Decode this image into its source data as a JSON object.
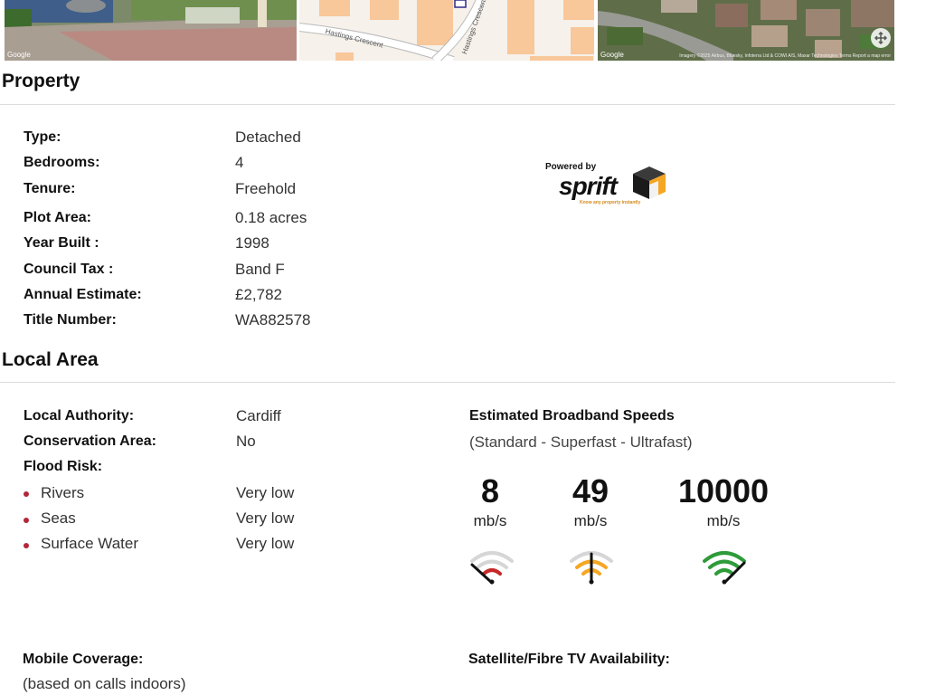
{
  "images": {
    "street_view_credit": "Google",
    "map_street_names": [
      "Hastings Crescent",
      "Hastings Crescent"
    ],
    "aerial_credit": "Google",
    "aerial_attribution": "Imagery ©2025 Airbus, Bluesky, Infoterra Ltd & COWI A/S, Maxar Technologies   Terms   Report a map error"
  },
  "property": {
    "title": "Property",
    "rows": [
      {
        "label": "Type:",
        "value": "Detached"
      },
      {
        "label": "Bedrooms:",
        "value": "4"
      },
      {
        "label": "Tenure:",
        "value": "Freehold"
      },
      {
        "label": "Plot Area:",
        "value": "0.18 acres"
      },
      {
        "label": "Year Built :",
        "value": "1998"
      },
      {
        "label": "Council Tax :",
        "value": "Band F"
      },
      {
        "label": "Annual Estimate:",
        "value": "£2,782"
      },
      {
        "label": "Title Number:",
        "value": "WA882578"
      }
    ],
    "logo": {
      "powered_by": "Powered by",
      "brand": "sprift",
      "tagline": "Know any property instantly",
      "brand_color": "#f5a623"
    }
  },
  "local_area": {
    "title": "Local Area",
    "rows": [
      {
        "label": "Local Authority:",
        "value": "Cardiff"
      },
      {
        "label": "Conservation Area:",
        "value": "No"
      },
      {
        "label": "Flood Risk:",
        "value": ""
      }
    ],
    "flood_risk": [
      {
        "label": "Rivers",
        "value": "Very low"
      },
      {
        "label": "Seas",
        "value": "Very low"
      },
      {
        "label": "Surface Water",
        "value": "Very low"
      }
    ],
    "broadband": {
      "title": "Estimated Broadband Speeds",
      "subtitle": "(Standard - Superfast - Ultrafast)",
      "speeds": [
        {
          "value": "8",
          "unit": "mb/s",
          "color": "#c62828"
        },
        {
          "value": "49",
          "unit": "mb/s",
          "color": "#f5a623"
        },
        {
          "value": "10000",
          "unit": "mb/s",
          "color": "#2e9b3a"
        }
      ]
    },
    "mobile": {
      "title": "Mobile Coverage:",
      "subtitle": "(based on calls indoors)"
    },
    "tv": {
      "title": "Satellite/Fibre TV Availability:"
    }
  },
  "colors": {
    "bullet": "#b3263a",
    "divider": "#dcdcdc"
  }
}
